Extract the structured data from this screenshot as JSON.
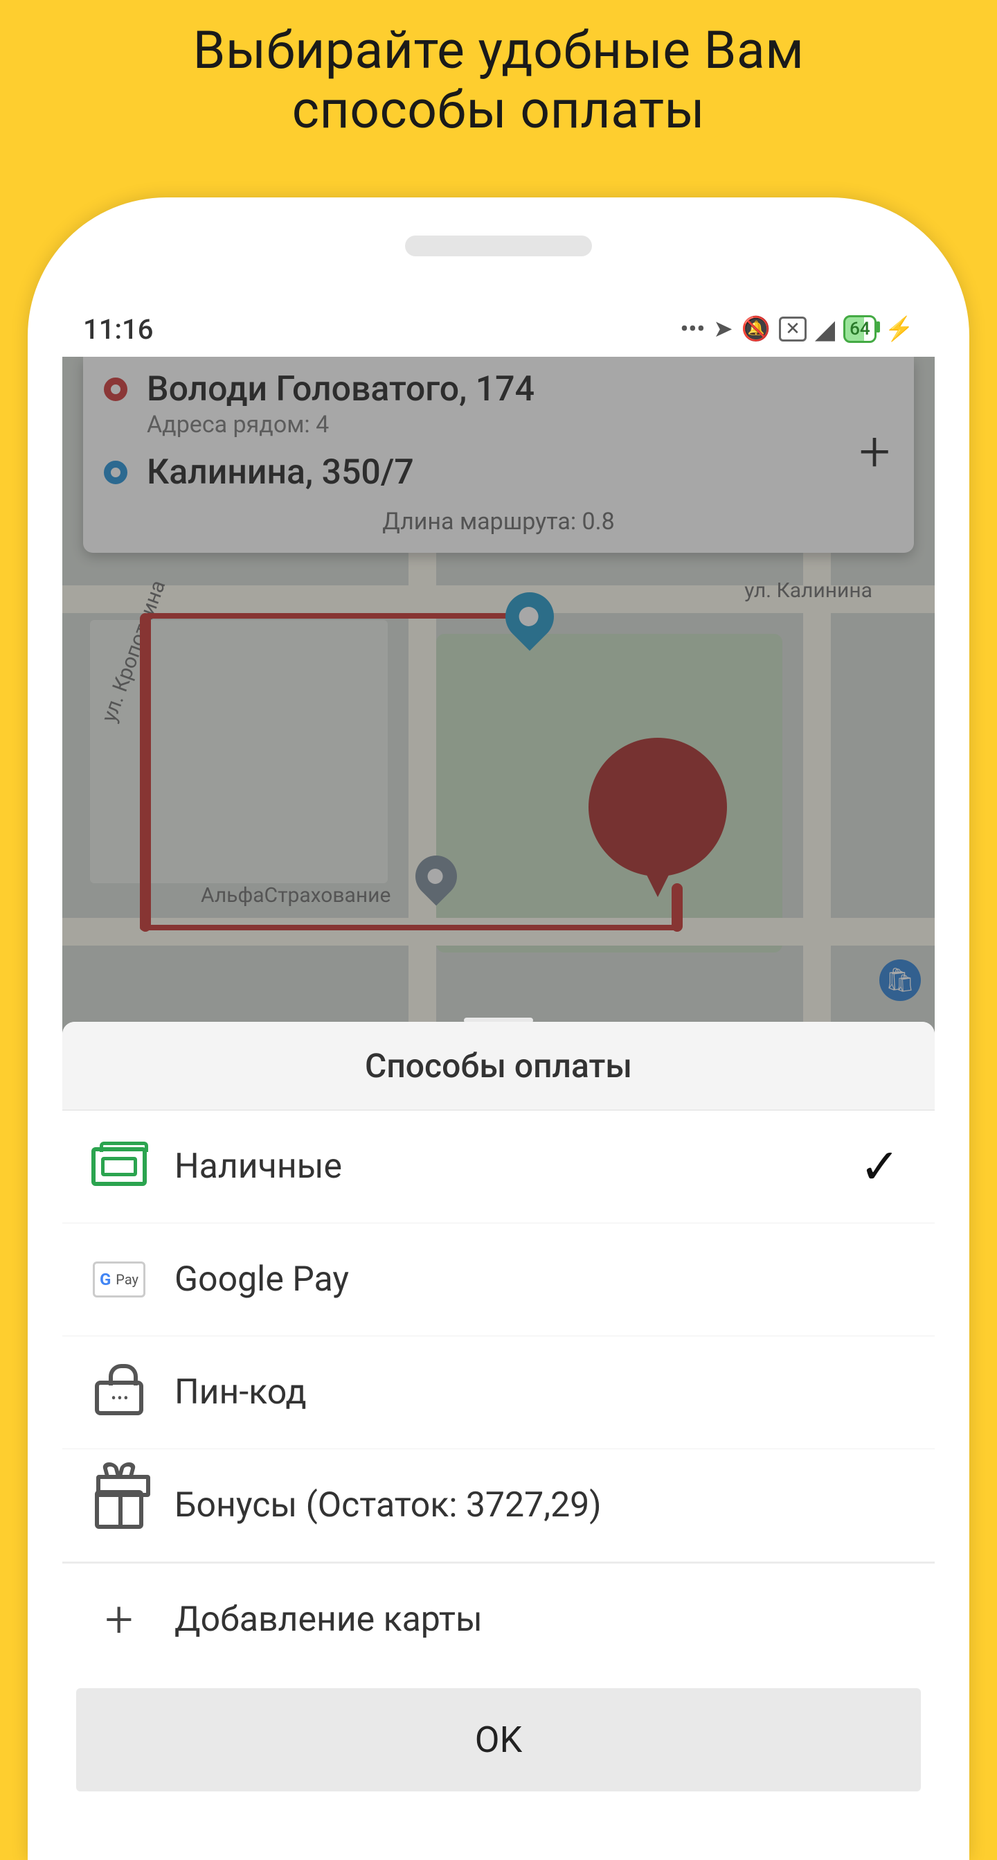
{
  "promo": {
    "title_line1": "Выбирайте удобные Вам",
    "title_line2": "способы оплаты"
  },
  "status_bar": {
    "time": "11:16",
    "battery_pct": "64"
  },
  "route": {
    "from_address": "Володи Головатого, 174",
    "from_sub": "Адреса рядом: 4",
    "to_address": "Калинина, 350/7",
    "length_label": "Длина маршрута: 0.8"
  },
  "map": {
    "poi_insurance": "АльфаСтрахование",
    "street_kalinina": "ул. Калинина",
    "street_kropotkina": "ул. Кропоткина"
  },
  "sheet": {
    "title": "Способы оплаты",
    "ok_label": "OK"
  },
  "payment_methods": {
    "cash": "Наличные",
    "gpay": "Google Pay",
    "pin": "Пин-код",
    "bonus": "Бонусы (Остаток: 3727,29)",
    "add_card": "Добавление карты"
  }
}
